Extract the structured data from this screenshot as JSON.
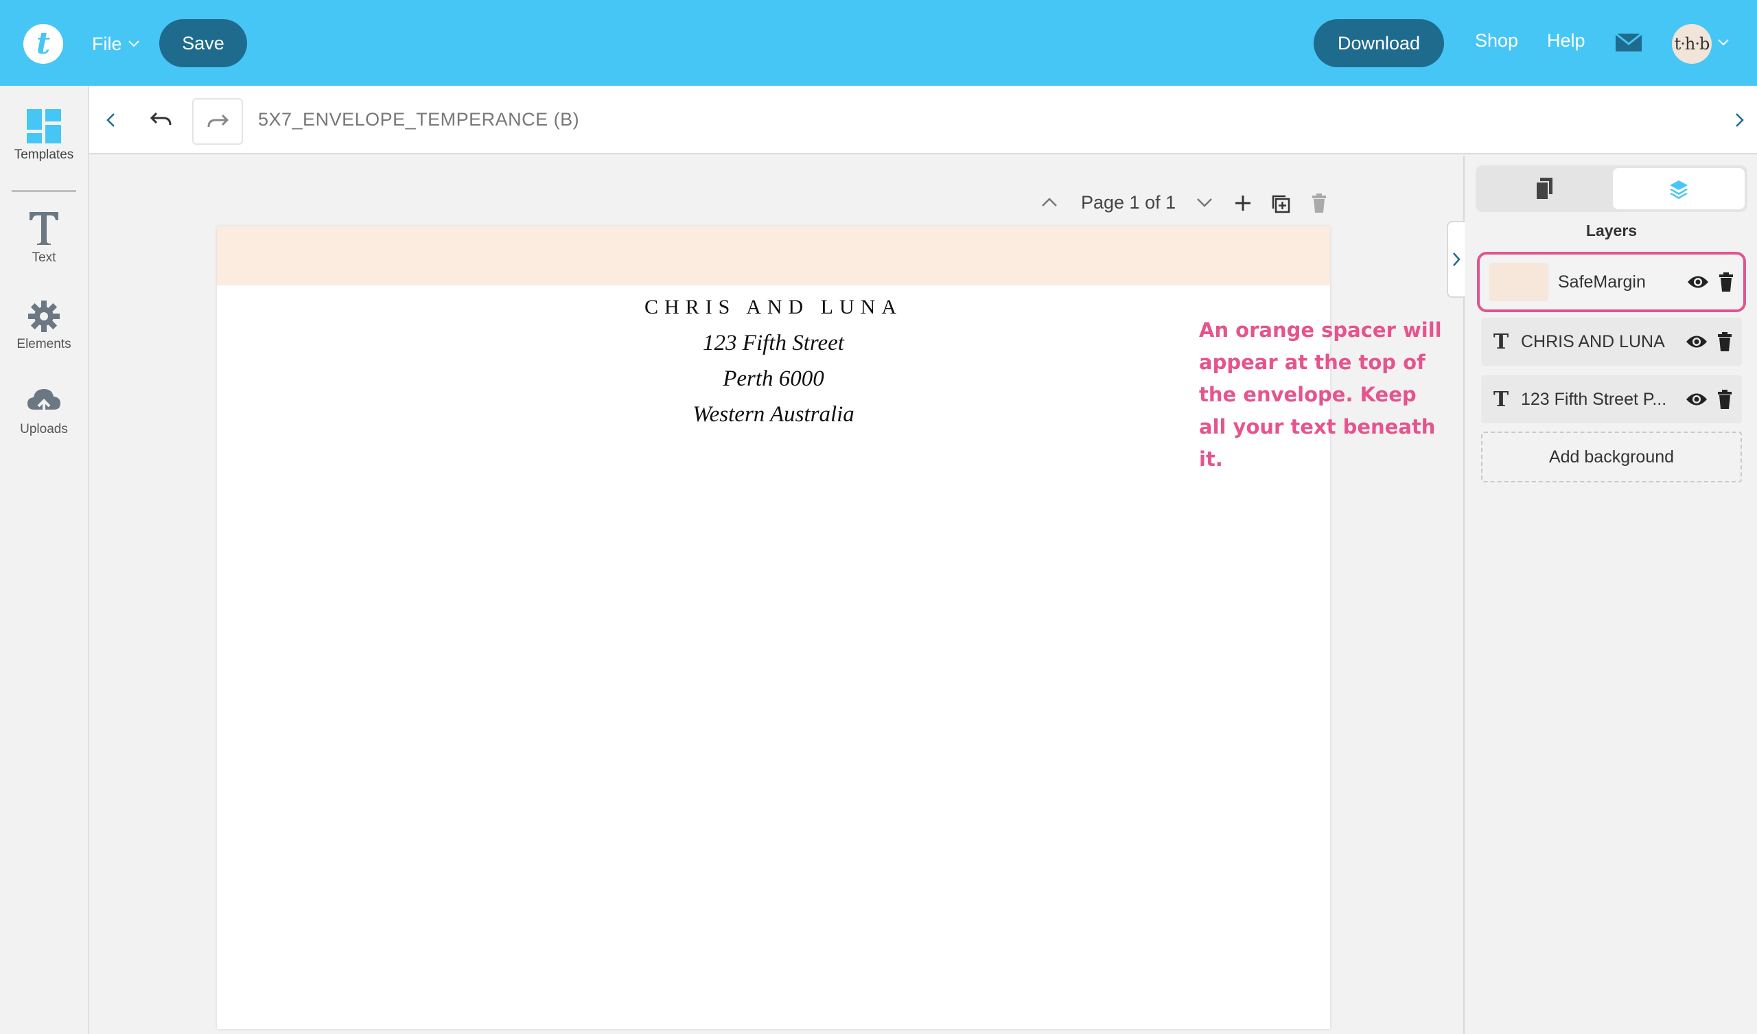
{
  "topbar": {
    "logo_letter": "t",
    "file_label": "File",
    "save_label": "Save",
    "download_label": "Download",
    "shop_label": "Shop",
    "help_label": "Help",
    "avatar_text": "t·h·b",
    "mail_icon": "envelope-icon",
    "color": "#46c6f5",
    "button_color": "#1f6b8e"
  },
  "sidebar": {
    "items": [
      {
        "label": "Templates",
        "icon": "templates-grid-icon"
      },
      {
        "label": "Text",
        "icon": "text-t-icon"
      },
      {
        "label": "Elements",
        "icon": "gear-icon"
      },
      {
        "label": "Uploads",
        "icon": "cloud-upload-icon"
      }
    ]
  },
  "docbar": {
    "title": "5X7_ENVELOPE_TEMPERANCE (B)"
  },
  "canvas": {
    "page_indicator": "Page 1 of 1",
    "address": {
      "name": "CHRIS AND LUNA",
      "line1": "123 Fifth Street",
      "line2": "Perth 6000",
      "line3": "Western Australia"
    },
    "note": "An orange spacer will appear at the top of the envelope. Keep all your text beneath it.",
    "note_color": "#e5548d",
    "safe_margin_color": "#fcebdf"
  },
  "layers_panel": {
    "title": "Layers",
    "layers": [
      {
        "name": "SafeMargin",
        "type": "shape",
        "selected": true
      },
      {
        "name": "CHRIS AND LUNA",
        "type": "text"
      },
      {
        "name": "123 Fifth Street P...",
        "type": "text"
      }
    ],
    "add_background_label": "Add background",
    "selection_color": "#e0558f"
  }
}
